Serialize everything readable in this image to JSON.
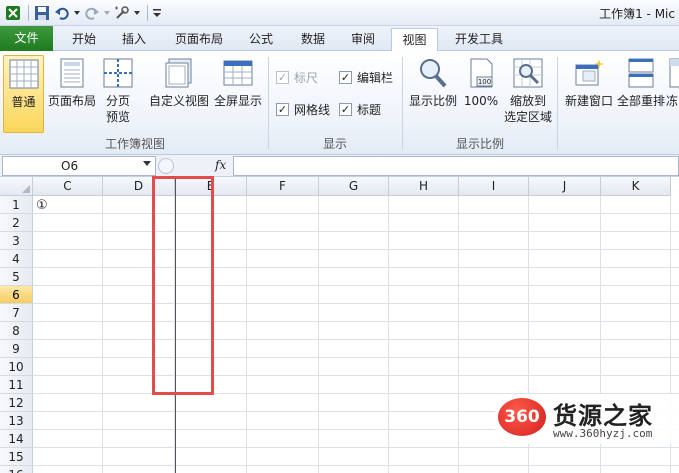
{
  "window": {
    "title": "工作簿1 - Mic"
  },
  "quick_access": {
    "icons": [
      "save-icon",
      "undo-icon",
      "redo-icon",
      "tools-icon",
      "customize-icon"
    ]
  },
  "tabs": [
    {
      "id": "file",
      "label": "文件"
    },
    {
      "id": "home",
      "label": "开始"
    },
    {
      "id": "insert",
      "label": "插入"
    },
    {
      "id": "layout",
      "label": "页面布局"
    },
    {
      "id": "formulas",
      "label": "公式"
    },
    {
      "id": "data",
      "label": "数据"
    },
    {
      "id": "review",
      "label": "审阅"
    },
    {
      "id": "view",
      "label": "视图"
    },
    {
      "id": "developer",
      "label": "开发工具"
    }
  ],
  "active_tab": "视图",
  "ribbon": {
    "workbook_views": {
      "label": "工作簿视图",
      "normal": "普通",
      "page_layout": "页面布局",
      "page_break_preview_1": "分页",
      "page_break_preview_2": "预览",
      "custom_views": "自定义视图",
      "full_screen": "全屏显示"
    },
    "show": {
      "label": "显示",
      "ruler": {
        "label": "标尺",
        "checked": true,
        "disabled": true
      },
      "formula_bar": {
        "label": "编辑栏",
        "checked": true
      },
      "gridlines": {
        "label": "网格线",
        "checked": true
      },
      "headings": {
        "label": "标题",
        "checked": true
      }
    },
    "zoom": {
      "label": "显示比例",
      "zoom": "显示比例",
      "hundred": "100%",
      "to_selection_1": "缩放到",
      "to_selection_2": "选定区域"
    },
    "window": {
      "new_window": "新建窗口",
      "arrange_all": "全部重排",
      "freeze": "冻"
    }
  },
  "formula_bar": {
    "name_box": "O6",
    "fx": "fx",
    "value": ""
  },
  "grid": {
    "columns": [
      "C",
      "D",
      "E",
      "F",
      "G",
      "H",
      "I",
      "J",
      "K"
    ],
    "rows": [
      "1",
      "2",
      "3",
      "4",
      "5",
      "6",
      "7",
      "8",
      "9",
      "10",
      "11",
      "12",
      "13",
      "14",
      "15",
      "16"
    ],
    "selected_row": "6",
    "cells": {
      "C1": "①"
    }
  },
  "watermark": {
    "logo": "360",
    "name": "货源之家",
    "url": "www.360hyzj.com"
  },
  "colors": {
    "file_tab": "#2a8a2a",
    "highlight_box": "#e34c4c",
    "selected": "#f7cd62"
  }
}
